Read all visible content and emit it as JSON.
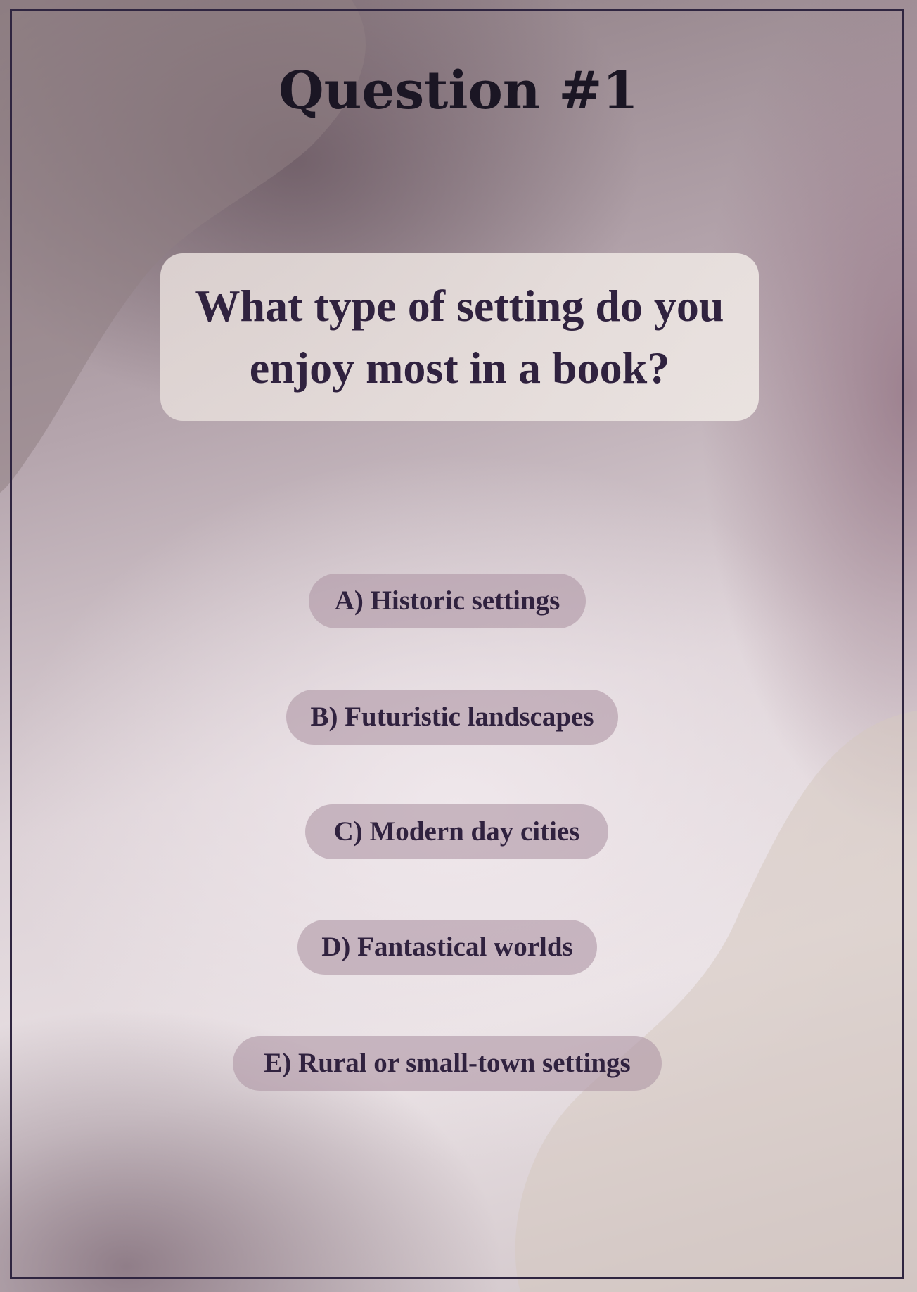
{
  "page": {
    "heading": "Question #1"
  },
  "question": {
    "text": "What type of setting do you enjoy most in a book?"
  },
  "options": [
    {
      "label": "A) Historic settings"
    },
    {
      "label": "B) Futuristic landscapes"
    },
    {
      "label": "C) Modern day cities"
    },
    {
      "label": "D) Fantastical worlds"
    },
    {
      "label": "E) Rural or small-town settings"
    }
  ],
  "colors": {
    "frame_border": "#2f2540",
    "heading_text": "#1b1624",
    "body_text": "#30223f",
    "option_pill": "#b098a6",
    "card_background": "#e6dcd9"
  }
}
